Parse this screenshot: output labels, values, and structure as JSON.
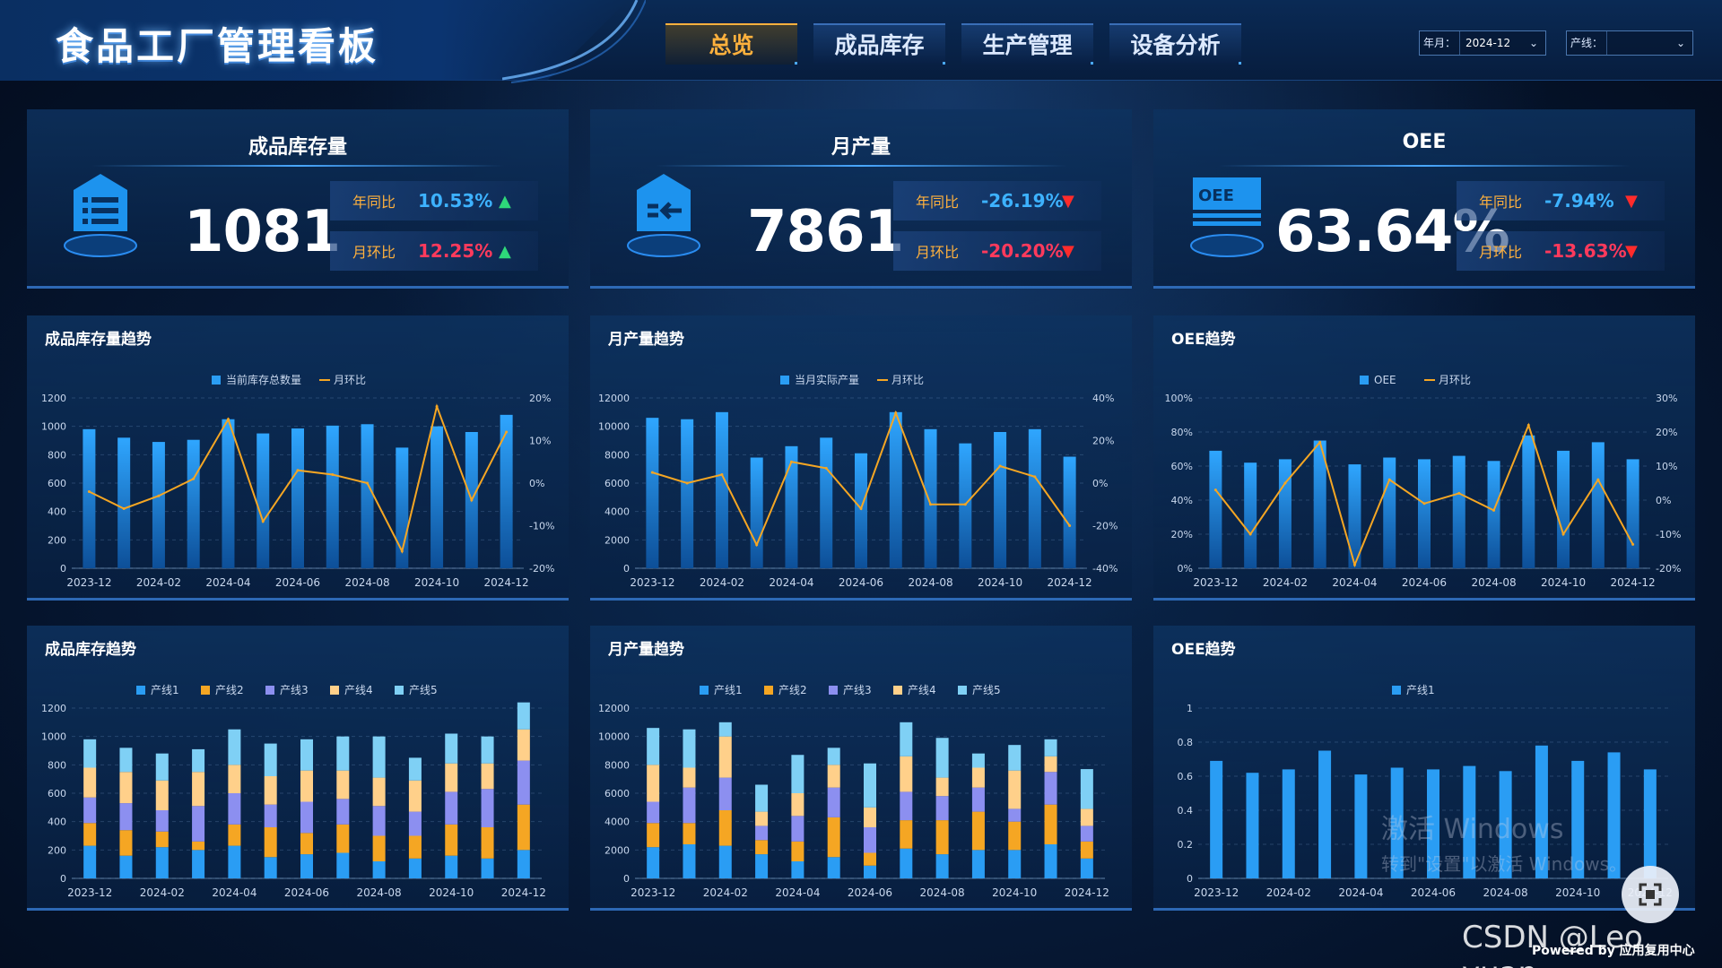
{
  "header": {
    "title": "食品工厂管理看板",
    "tabs": [
      {
        "label": "总览",
        "active": true
      },
      {
        "label": "成品库存",
        "active": false
      },
      {
        "label": "生产管理",
        "active": false
      },
      {
        "label": "设备分析",
        "active": false
      }
    ],
    "filters": {
      "month_label": "年月：",
      "month_value": "2024-12",
      "line_label": "产线：",
      "line_value": ""
    }
  },
  "kpis": [
    {
      "title": "成品库存量",
      "icon": "list-box-icon",
      "value": "1081",
      "yoy_label": "年同比",
      "yoy_value": "10.53%",
      "yoy_dir": "up",
      "mom_label": "月环比",
      "mom_value": "12.25%",
      "mom_dir": "up"
    },
    {
      "title": "月产量",
      "icon": "inbound-arrow-box-icon",
      "value": "7861",
      "yoy_label": "年同比",
      "yoy_value": "-26.19%",
      "yoy_dir": "down",
      "mom_label": "月环比",
      "mom_value": "-20.20%",
      "mom_dir": "down"
    },
    {
      "title": "OEE",
      "icon": "oee-monitor-icon",
      "icon_text": "OEE",
      "value": "63.64%",
      "yoy_label": "年同比",
      "yoy_value": "-7.94%",
      "yoy_dir": "down",
      "mom_label": "月环比",
      "mom_value": "-13.63%",
      "mom_dir": "down"
    }
  ],
  "colors": {
    "bar": "#2a9df4",
    "line": "#f5a623",
    "line1": "#2a9df4",
    "line2": "#f5a623",
    "line3": "#8c8ff0",
    "line4": "#ffd08a",
    "line5": "#7fd0f5",
    "positive_pct": "#3db2ff",
    "negative_pct": "#ff3a5c",
    "arrow_up": "#2ed87a",
    "arrow_down": "#ff2b2b",
    "active_tab": "#ffb13d"
  },
  "watermark": {
    "line1": "激活 Windows",
    "line2": "转到\"设置\"以激活 Windows。",
    "csdn": "CSDN @Leo yuan",
    "powered": "Powered by 应用复用中心"
  },
  "chart_data": [
    {
      "title": "成品库存量趋势",
      "type": "bar+line",
      "categories": [
        "2023-12",
        "2024-01",
        "2024-02",
        "2024-03",
        "2024-04",
        "2024-05",
        "2024-06",
        "2024-07",
        "2024-08",
        "2024-09",
        "2024-10",
        "2024-11",
        "2024-12"
      ],
      "x_tick_labels": [
        "2023-12",
        "2024-02",
        "2024-04",
        "2024-06",
        "2024-08",
        "2024-10",
        "2024-12"
      ],
      "series": [
        {
          "name": "当前库存总数量",
          "kind": "bar",
          "axis": "left",
          "values": [
            980,
            920,
            890,
            905,
            1050,
            950,
            985,
            1005,
            1015,
            850,
            1000,
            960,
            1081
          ]
        },
        {
          "name": "月环比",
          "kind": "line",
          "axis": "right",
          "values": [
            -2,
            -6,
            -3,
            1,
            15,
            -9,
            3,
            2,
            0,
            -16,
            18,
            -4,
            12
          ]
        }
      ],
      "ylim_left": [
        0,
        1200
      ],
      "y_ticks_left": [
        "0",
        "200",
        "400",
        "600",
        "800",
        "1000",
        "1200"
      ],
      "ylim_right": [
        -20,
        20
      ],
      "y_ticks_right": [
        "-20%",
        "-10%",
        "0%",
        "10%",
        "20%"
      ],
      "legend": "top-center"
    },
    {
      "title": "月产量趋势",
      "type": "bar+line",
      "categories": [
        "2023-12",
        "2024-01",
        "2024-02",
        "2024-03",
        "2024-04",
        "2024-05",
        "2024-06",
        "2024-07",
        "2024-08",
        "2024-09",
        "2024-10",
        "2024-11",
        "2024-12"
      ],
      "x_tick_labels": [
        "2023-12",
        "2024-02",
        "2024-04",
        "2024-06",
        "2024-08",
        "2024-10",
        "2024-12"
      ],
      "series": [
        {
          "name": "当月实际产量",
          "kind": "bar",
          "axis": "left",
          "values": [
            10600,
            10500,
            11000,
            7800,
            8600,
            9200,
            8100,
            11000,
            9800,
            8800,
            9600,
            9800,
            7861
          ]
        },
        {
          "name": "月环比",
          "kind": "line",
          "axis": "right",
          "values": [
            5,
            0,
            4,
            -29,
            10,
            7,
            -12,
            33,
            -10,
            -10,
            8,
            3,
            -20
          ]
        }
      ],
      "ylim_left": [
        0,
        12000
      ],
      "y_ticks_left": [
        "0",
        "2000",
        "4000",
        "6000",
        "8000",
        "10000",
        "12000"
      ],
      "ylim_right": [
        -40,
        40
      ],
      "y_ticks_right": [
        "-40%",
        "-20%",
        "0%",
        "20%",
        "40%"
      ],
      "legend": "top-center"
    },
    {
      "title": "OEE趋势",
      "type": "bar+line",
      "categories": [
        "2023-12",
        "2024-01",
        "2024-02",
        "2024-03",
        "2024-04",
        "2024-05",
        "2024-06",
        "2024-07",
        "2024-08",
        "2024-09",
        "2024-10",
        "2024-11",
        "2024-12"
      ],
      "x_tick_labels": [
        "2023-12",
        "2024-02",
        "2024-04",
        "2024-06",
        "2024-08",
        "2024-10",
        "2024-12"
      ],
      "series": [
        {
          "name": "OEE",
          "kind": "bar",
          "axis": "left",
          "values": [
            69,
            62,
            64,
            75,
            61,
            65,
            64,
            66,
            63,
            78,
            69,
            74,
            64
          ]
        },
        {
          "name": "月环比",
          "kind": "line",
          "axis": "right",
          "values": [
            3,
            -10,
            5,
            17,
            -19,
            6,
            -1,
            2,
            -3,
            22,
            -10,
            6,
            -13
          ]
        }
      ],
      "ylim_left": [
        0,
        100
      ],
      "y_ticks_left": [
        "0%",
        "20%",
        "40%",
        "60%",
        "80%",
        "100%"
      ],
      "ylim_right": [
        -20,
        30
      ],
      "y_ticks_right": [
        "-20%",
        "-10%",
        "0%",
        "10%",
        "20%",
        "30%"
      ],
      "legend": "top-center"
    },
    {
      "title": "成品库存趋势",
      "type": "stacked-bar",
      "categories": [
        "2023-12",
        "2024-01",
        "2024-02",
        "2024-03",
        "2024-04",
        "2024-05",
        "2024-06",
        "2024-07",
        "2024-08",
        "2024-09",
        "2024-10",
        "2024-11",
        "2024-12"
      ],
      "x_tick_labels": [
        "2023-12",
        "2024-02",
        "2024-04",
        "2024-06",
        "2024-08",
        "2024-10",
        "2024-12"
      ],
      "series": [
        {
          "name": "产线1",
          "values": [
            230,
            160,
            220,
            200,
            230,
            150,
            170,
            180,
            120,
            140,
            160,
            140,
            200
          ]
        },
        {
          "name": "产线2",
          "values": [
            160,
            180,
            110,
            60,
            150,
            210,
            150,
            200,
            180,
            160,
            220,
            220,
            320
          ]
        },
        {
          "name": "产线3",
          "values": [
            180,
            190,
            150,
            250,
            220,
            160,
            220,
            180,
            210,
            170,
            230,
            270,
            310
          ]
        },
        {
          "name": "产线4",
          "values": [
            210,
            220,
            210,
            240,
            200,
            200,
            220,
            200,
            200,
            220,
            200,
            180,
            220
          ]
        },
        {
          "name": "产线5",
          "values": [
            200,
            170,
            190,
            160,
            250,
            230,
            220,
            240,
            290,
            160,
            210,
            190,
            190
          ]
        }
      ],
      "ylim": [
        0,
        1200
      ],
      "y_ticks": [
        "0",
        "200",
        "400",
        "600",
        "800",
        "1000",
        "1200"
      ],
      "legend": "top-center"
    },
    {
      "title": "月产量趋势",
      "type": "stacked-bar",
      "categories": [
        "2023-12",
        "2024-01",
        "2024-02",
        "2024-03",
        "2024-04",
        "2024-05",
        "2024-06",
        "2024-07",
        "2024-08",
        "2024-09",
        "2024-10",
        "2024-11",
        "2024-12"
      ],
      "x_tick_labels": [
        "2023-12",
        "2024-02",
        "2024-04",
        "2024-06",
        "2024-08",
        "2024-10",
        "2024-12"
      ],
      "series": [
        {
          "name": "产线1",
          "values": [
            2200,
            2400,
            2300,
            1700,
            1200,
            1500,
            900,
            2100,
            1700,
            2000,
            2000,
            2400,
            1400
          ]
        },
        {
          "name": "产线2",
          "values": [
            1700,
            1500,
            2500,
            1000,
            1400,
            2800,
            900,
            2000,
            2400,
            2700,
            2000,
            2800,
            1200
          ]
        },
        {
          "name": "产线3",
          "values": [
            1500,
            2500,
            2300,
            1000,
            1800,
            2100,
            1800,
            2000,
            1700,
            1700,
            900,
            2300,
            1100
          ]
        },
        {
          "name": "产线4",
          "values": [
            2600,
            1400,
            2900,
            1000,
            1600,
            1600,
            1400,
            2500,
            1300,
            1400,
            2700,
            1100,
            1200
          ]
        },
        {
          "name": "产线5",
          "values": [
            2600,
            2700,
            1000,
            1900,
            2700,
            1200,
            3100,
            2400,
            2800,
            1000,
            1800,
            1200,
            2800
          ]
        }
      ],
      "ylim": [
        0,
        12000
      ],
      "y_ticks": [
        "0",
        "2000",
        "4000",
        "6000",
        "8000",
        "10000",
        "12000"
      ],
      "legend": "top-center"
    },
    {
      "title": "OEE趋势",
      "type": "bar",
      "categories": [
        "2023-12",
        "2024-01",
        "2024-02",
        "2024-03",
        "2024-04",
        "2024-05",
        "2024-06",
        "2024-07",
        "2024-08",
        "2024-09",
        "2024-10",
        "2024-11",
        "2024-12"
      ],
      "x_tick_labels": [
        "2023-12",
        "2024-02",
        "2024-04",
        "2024-06",
        "2024-08",
        "2024-10",
        "2024-12"
      ],
      "series": [
        {
          "name": "产线1",
          "values": [
            0.69,
            0.62,
            0.64,
            0.75,
            0.61,
            0.65,
            0.64,
            0.66,
            0.63,
            0.78,
            0.69,
            0.74,
            0.64
          ]
        }
      ],
      "ylim": [
        0,
        1
      ],
      "y_ticks": [
        "0",
        "0.2",
        "0.4",
        "0.6",
        "0.8",
        "1"
      ],
      "legend": "top-center"
    }
  ]
}
